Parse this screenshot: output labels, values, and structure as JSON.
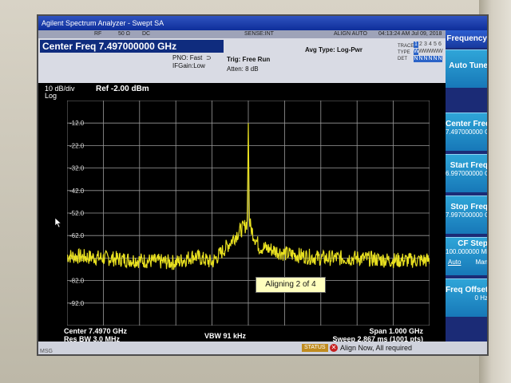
{
  "window": {
    "title": "Agilent Spectrum Analyzer - Swept SA"
  },
  "status_strip": {
    "rf": "RF",
    "impedance": "50 Ω",
    "coupling": "DC",
    "sense": "SENSE:INT",
    "align": "ALIGN AUTO",
    "timestamp": "04:13:24 AM Jul 09, 2018"
  },
  "info": {
    "center_freq": "Center Freq 7.497000000 GHz",
    "pno": "PNO: Fast",
    "ifgain": "IFGain:Low",
    "trig": "Trig: Free Run",
    "atten": "Atten: 8 dB",
    "avg_type": "Avg Type: Log-Pwr",
    "trace_label": "TRACE",
    "type_label": "TYPE",
    "det_label": "DET",
    "trace_row": [
      "1",
      "2",
      "3",
      "4",
      "5",
      "6"
    ],
    "type_row": [
      "W",
      "W",
      "W",
      "W",
      "W",
      "W"
    ],
    "det_row": [
      "N",
      "N",
      "N",
      "N",
      "N",
      "N"
    ]
  },
  "plot": {
    "scale": "10 dB/div",
    "log": "Log",
    "ref": "Ref -2.00 dBm",
    "y_ticks": [
      "-12.0",
      "-22.0",
      "-32.0",
      "-42.0",
      "-52.0",
      "-62.0",
      "-72.0",
      "-82.0",
      "-92.0"
    ],
    "trace_color": "#e8e020",
    "grid_color": "#9a9a9a"
  },
  "footer": {
    "center": "Center 7.4970 GHz",
    "res_bw": "Res BW 3.0 MHz",
    "vbw": "VBW 91 kHz",
    "span": "Span 1.000 GHz",
    "sweep": "Sweep  2.867 ms (1001 pts)"
  },
  "popup": {
    "text": "Aligning 2 of 4"
  },
  "message_bar": {
    "msg": "MSG",
    "status": "STATUS",
    "align_message": "Align Now, All required"
  },
  "softkeys": {
    "title": "Frequency",
    "items": [
      {
        "label": "Auto Tune",
        "value": ""
      },
      {
        "label": "Center Freq",
        "value": "7.497000000 GHz"
      },
      {
        "label": "Start Freq",
        "value": "6.997000000 GHz"
      },
      {
        "label": "Stop Freq",
        "value": "7.997000000 GHz"
      },
      {
        "label": "CF Step",
        "value": "100.000000 MHz",
        "auto": "Auto",
        "man": "Man"
      },
      {
        "label": "Freq Offset",
        "value": "0 Hz"
      }
    ]
  },
  "chart_data": {
    "type": "line",
    "xlabel": "",
    "ylabel": "",
    "x_range_ghz": [
      6.997,
      7.997
    ],
    "ylim": [
      -102,
      -2
    ],
    "y_ticks": [
      -12,
      -22,
      -32,
      -42,
      -52,
      -62,
      -72,
      -82,
      -92
    ],
    "grid": true,
    "series": [
      {
        "x": [
          6.997,
          7.097,
          7.197,
          7.297,
          7.347,
          7.397,
          7.437,
          7.467,
          7.487,
          7.494,
          7.497,
          7.5,
          7.507,
          7.527,
          7.557,
          7.597,
          7.697,
          7.797,
          7.897,
          7.997
        ],
        "y": [
          -71,
          -72,
          -73,
          -74,
          -71,
          -74,
          -67,
          -61,
          -58,
          -56,
          -12,
          -56,
          -60,
          -67,
          -68,
          -70,
          -72,
          -72,
          -73,
          -73
        ]
      }
    ]
  }
}
